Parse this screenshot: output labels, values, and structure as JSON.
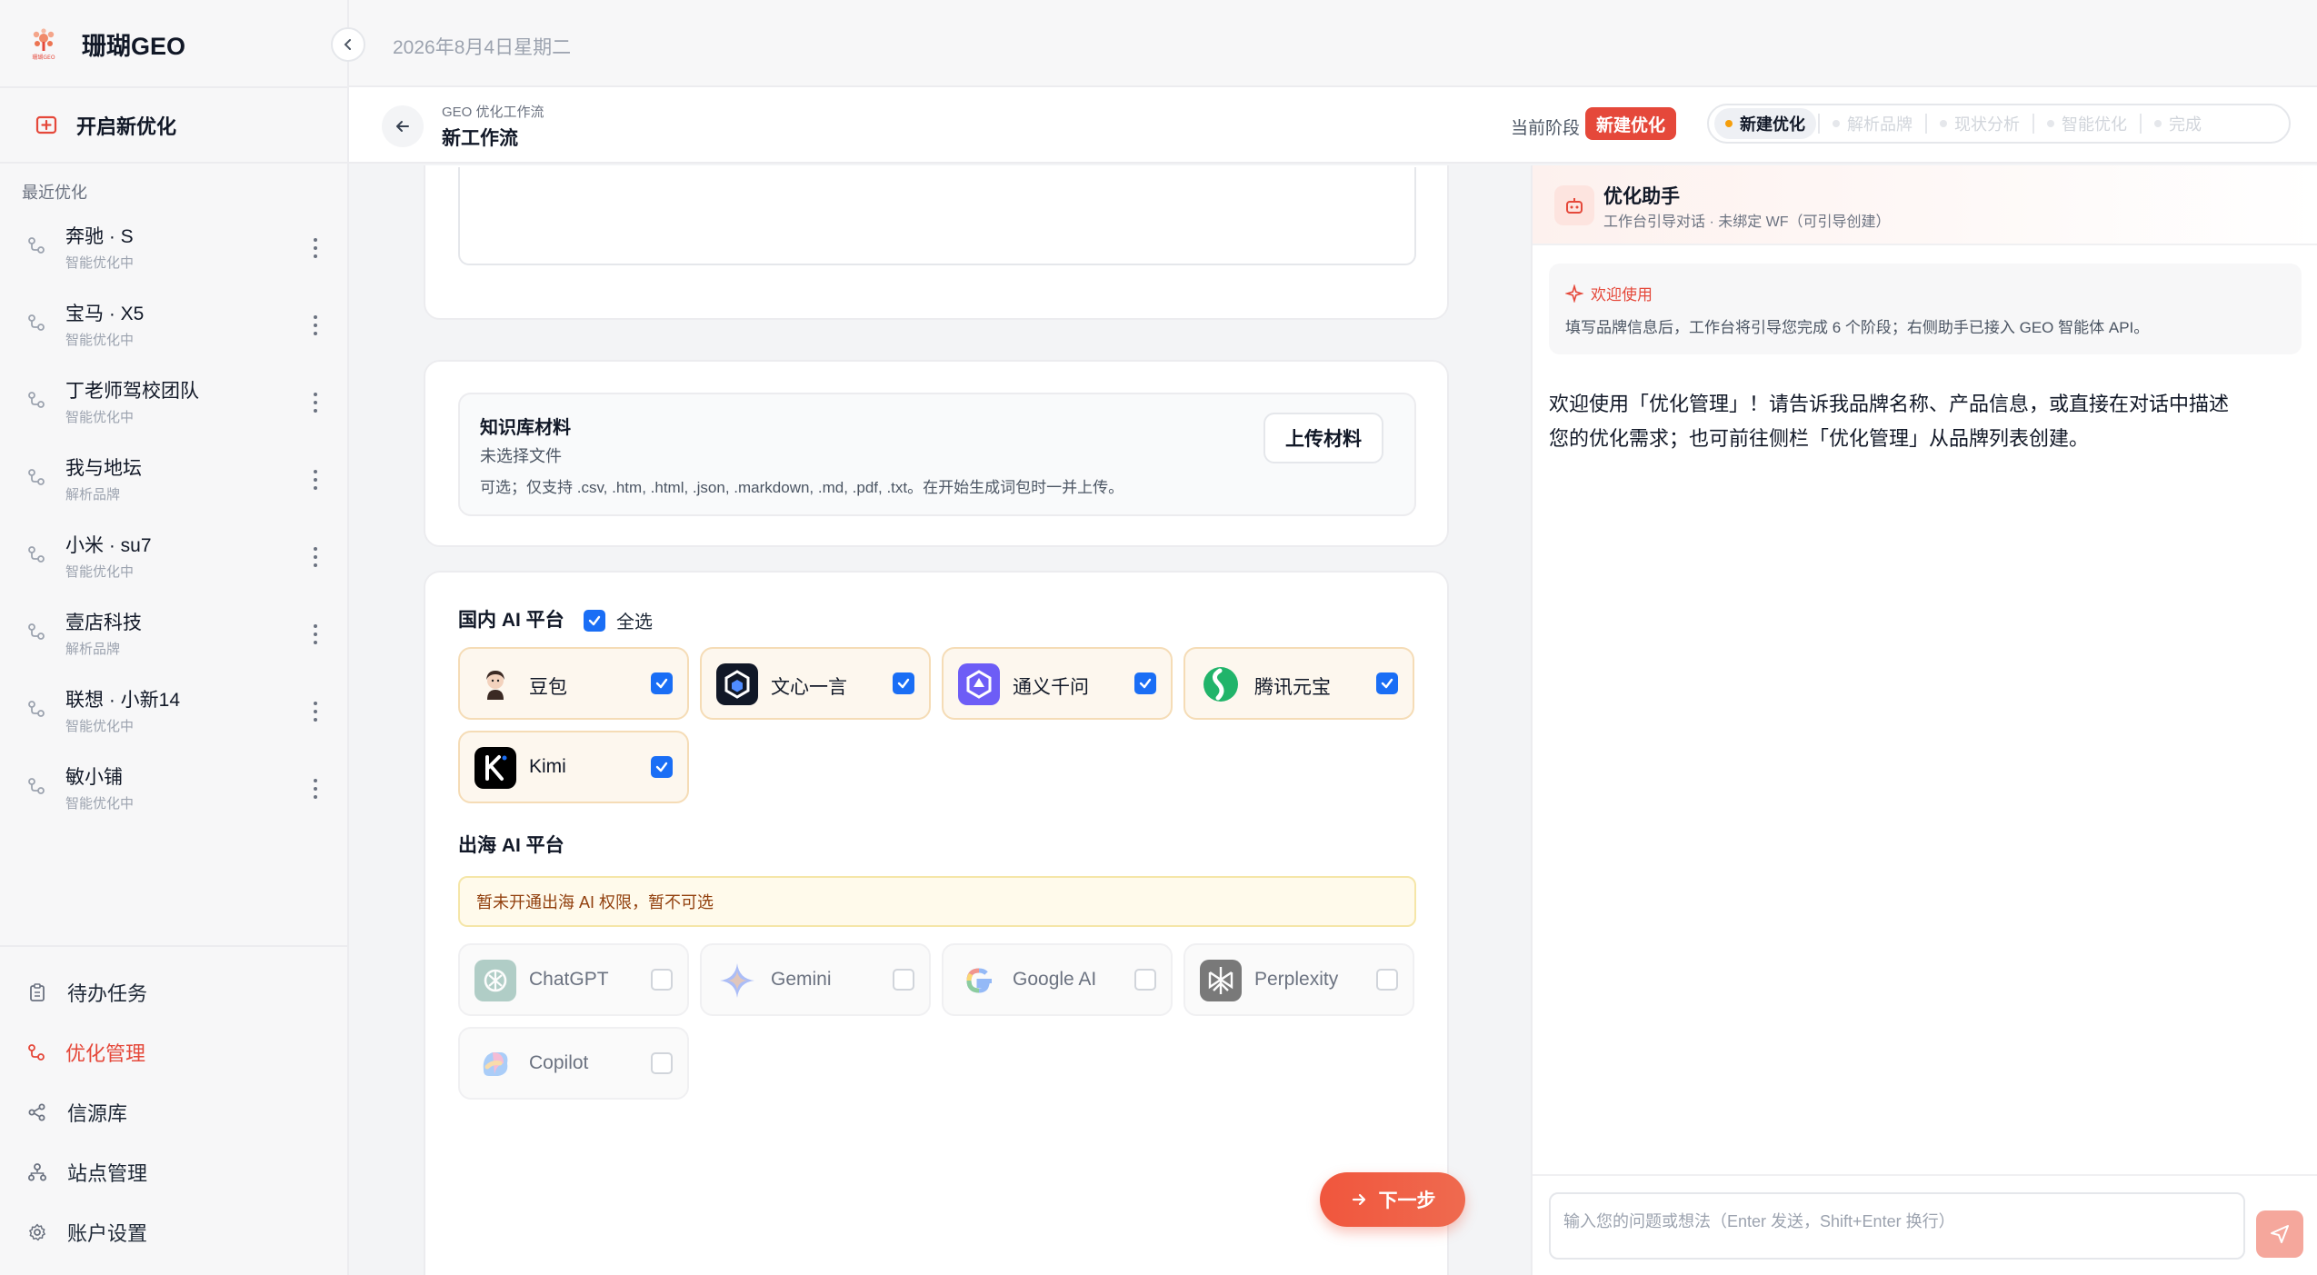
{
  "app": {
    "name": "珊瑚GEO",
    "logo_caption": "珊瑚GEO"
  },
  "sidebar": {
    "new_optimization": "开启新优化",
    "recent_title": "最近优化",
    "recent": [
      {
        "name": "奔驰 · S",
        "status": "智能优化中"
      },
      {
        "name": "宝马 · X5",
        "status": "智能优化中"
      },
      {
        "name": "丁老师驾校团队",
        "status": "智能优化中"
      },
      {
        "name": "我与地坛",
        "status": "解析品牌"
      },
      {
        "name": "小米 · su7",
        "status": "智能优化中"
      },
      {
        "name": "壹店科技",
        "status": "解析品牌"
      },
      {
        "name": "联想 · 小新14",
        "status": "智能优化中"
      },
      {
        "name": "敏小铺",
        "status": "智能优化中"
      }
    ],
    "nav": [
      {
        "label": "待办任务",
        "icon": "clipboard-icon",
        "active": false
      },
      {
        "label": "优化管理",
        "icon": "flow-icon",
        "active": true
      },
      {
        "label": "信源库",
        "icon": "share-icon",
        "active": false
      },
      {
        "label": "站点管理",
        "icon": "sitemap-icon",
        "active": false
      },
      {
        "label": "账户设置",
        "icon": "gear-icon",
        "active": false
      }
    ]
  },
  "header": {
    "date": "2026年8月4日星期二"
  },
  "workflow": {
    "subtitle": "GEO 优化工作流",
    "title": "新工作流",
    "stage_label": "当前阶段",
    "stage_badge": "新建优化",
    "steps": [
      "新建优化",
      "解析品牌",
      "现状分析",
      "智能优化",
      "完成"
    ],
    "active_step": 0
  },
  "knowledge": {
    "title": "知识库材料",
    "file": "未选择文件",
    "hint": "可选；仅支持 .csv, .htm, .html, .json, .markdown, .md, .pdf, .txt。在开始生成词包时一并上传。",
    "upload": "上传材料"
  },
  "domestic": {
    "title": "国内 AI 平台",
    "select_all": "全选",
    "platforms": [
      {
        "name": "豆包",
        "checked": true,
        "icon": "doubao-logo-icon"
      },
      {
        "name": "文心一言",
        "checked": true,
        "icon": "wenxin-logo-icon"
      },
      {
        "name": "通义千问",
        "checked": true,
        "icon": "tongyi-logo-icon"
      },
      {
        "name": "腾讯元宝",
        "checked": true,
        "icon": "yuanbao-logo-icon"
      },
      {
        "name": "Kimi",
        "checked": true,
        "icon": "kimi-logo-icon"
      }
    ]
  },
  "overseas": {
    "title": "出海 AI 平台",
    "warning": "暂未开通出海 AI 权限，暂不可选",
    "platforms": [
      {
        "name": "ChatGPT",
        "checked": false,
        "icon": "chatgpt-logo-icon"
      },
      {
        "name": "Gemini",
        "checked": false,
        "icon": "gemini-logo-icon"
      },
      {
        "name": "Google AI",
        "checked": false,
        "icon": "google-logo-icon"
      },
      {
        "name": "Perplexity",
        "checked": false,
        "icon": "perplexity-logo-icon"
      },
      {
        "name": "Copilot",
        "checked": false,
        "icon": "copilot-logo-icon"
      }
    ]
  },
  "next_button": "下一步",
  "assistant": {
    "title": "优化助手",
    "subtitle": "工作台引导对话 · 未绑定 WF（可引导创建）",
    "welcome_title": "欢迎使用",
    "welcome_body": "填写品牌信息后，工作台将引导您完成 6 个阶段；右侧助手已接入 GEO 智能体 API。",
    "message": "欢迎使用「优化管理」！请告诉我品牌名称、产品信息，或直接在对话中描述您的优化需求；也可前往侧栏「优化管理」从品牌列表创建。",
    "input_placeholder": "输入您的问题或想法（Enter 发送，Shift+Enter 换行）"
  },
  "colors": {
    "accent": "#e5483a",
    "checkbox": "#1a6ef5",
    "warning_bg": "#fffaeb"
  }
}
